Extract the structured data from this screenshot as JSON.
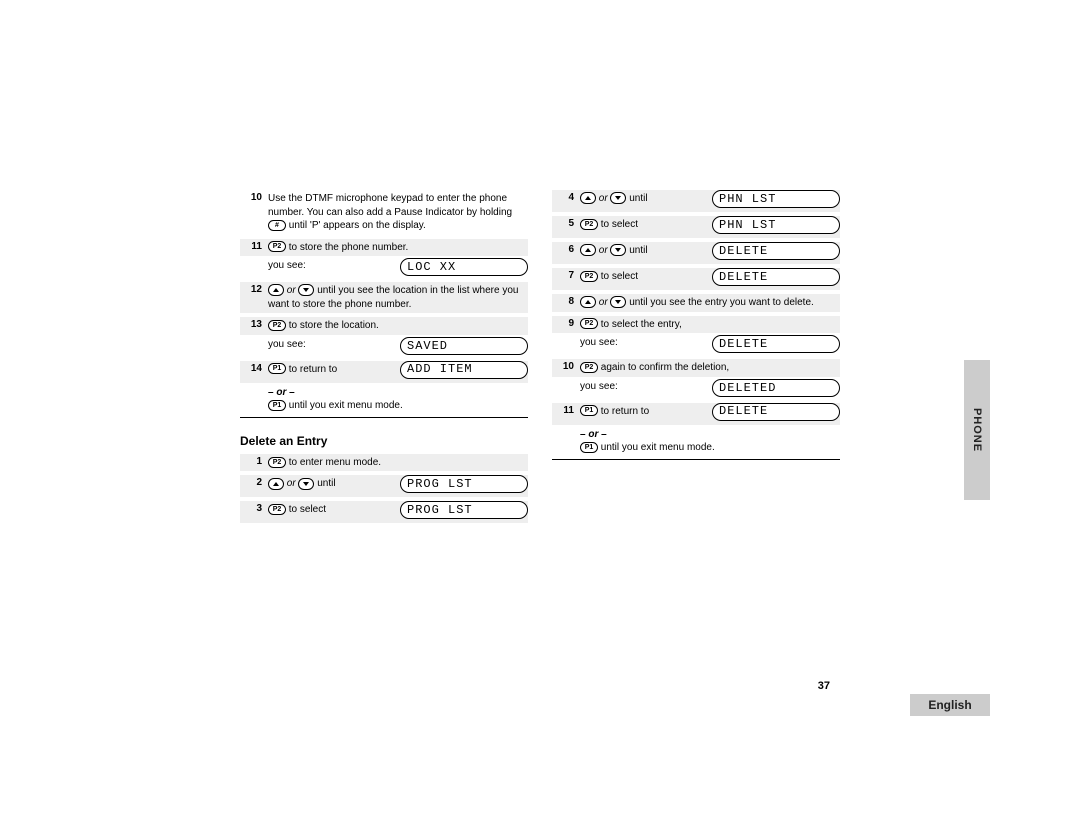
{
  "sideTab": "PHONE",
  "footerLang": "English",
  "pageNumber": "37",
  "leftCol": {
    "step10": {
      "num": "10",
      "text1": "Use the DTMF microphone keypad to enter the phone number. You can also add a Pause Indicator by holding ",
      "btn": "#",
      "text2": " until 'P' appears  on the display."
    },
    "step11": {
      "num": "11",
      "btn": "P2",
      "text": " to store the phone number."
    },
    "youSee1": {
      "label": "you see:",
      "lcd": "LOC  XX"
    },
    "step12": {
      "num": "12",
      "or": " or ",
      "text": " until you see the location in the list where you want to store the phone number."
    },
    "step13": {
      "num": "13",
      "btn": "P2",
      "text": " to store the location."
    },
    "youSee2": {
      "label": "you see:",
      "lcd": "SAVED"
    },
    "step14": {
      "num": "14",
      "btn": "P1",
      "text": " to return to",
      "lcd": "ADD  ITEM"
    },
    "orLine": "– or –",
    "exitLine": {
      "btn": "P1",
      "text": " until you exit menu mode."
    },
    "heading": "Delete an Entry",
    "d1": {
      "num": "1",
      "btn": "P2",
      "text": " to enter menu mode."
    },
    "d2": {
      "num": "2",
      "or": " or ",
      "until": " until",
      "lcd": "PROG  LST"
    },
    "d3": {
      "num": "3",
      "btn": "P2",
      "text": " to select",
      "lcd": "PROG  LST"
    }
  },
  "rightCol": {
    "r4": {
      "num": "4",
      "or": " or ",
      "until": " until",
      "lcd": "PHN  LST"
    },
    "r5": {
      "num": "5",
      "btn": "P2",
      "text": " to select",
      "lcd": "PHN  LST"
    },
    "r6": {
      "num": "6",
      "or": " or ",
      "until": " until",
      "lcd": "DELETE"
    },
    "r7": {
      "num": "7",
      "btn": "P2",
      "text": " to select",
      "lcd": "DELETE"
    },
    "r8": {
      "num": "8",
      "or": " or ",
      "text": " until you see the entry you want to delete."
    },
    "r9": {
      "num": "9",
      "btn": "P2",
      "text": " to select the entry,"
    },
    "youSee1": {
      "label": "you see:",
      "lcd": "DELETE"
    },
    "r10": {
      "num": "10",
      "btn": "P2",
      "text": " again to confirm the deletion,"
    },
    "youSee2": {
      "label": "you see:",
      "lcd": "DELETED"
    },
    "r11": {
      "num": "11",
      "btn": "P1",
      "text": " to return to",
      "lcd": "DELETE"
    },
    "orLine": "– or –",
    "exitLine": {
      "btn": "P1",
      "text": " until you exit menu mode."
    }
  }
}
